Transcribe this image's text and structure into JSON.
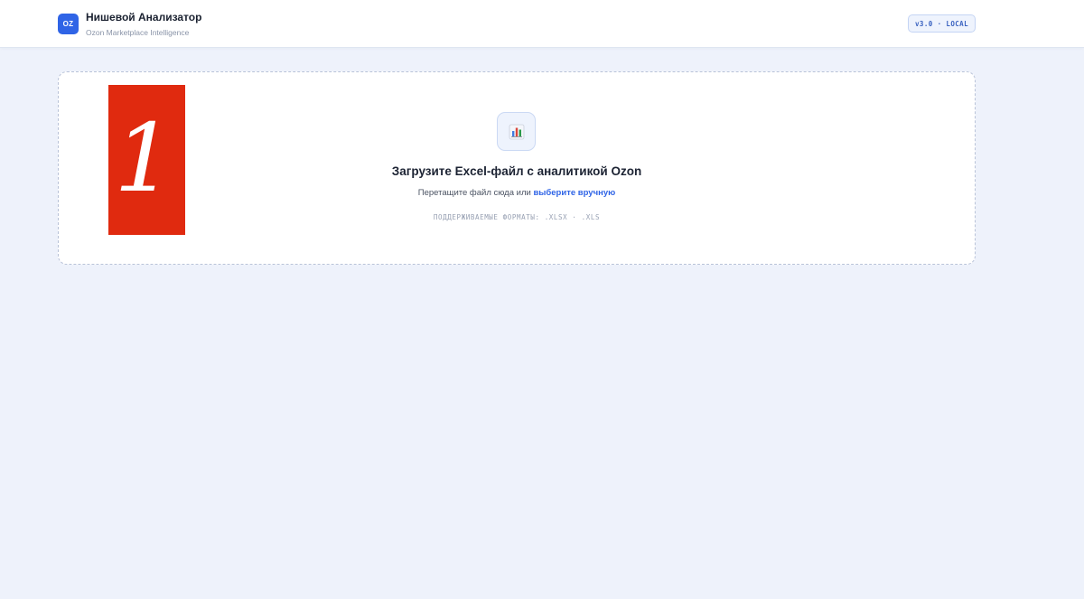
{
  "header": {
    "logo_text": "OZ",
    "title": "Нишевой Анализатор",
    "subtitle": "Ozon Marketplace Intelligence",
    "version": "v3.0 · LOCAL"
  },
  "overlay": {
    "number": "1",
    "color": "#e02a0f"
  },
  "upload": {
    "icon": "bar-chart-icon",
    "title": "Загрузите Excel-файл с аналитикой Ozon",
    "hint_prefix": "Перетащите файл сюда или",
    "hint_link": "выберите вручную",
    "formats": "ПОДДЕРЖИВАЕМЫЕ ФОРМАТЫ: .XLSX · .XLS"
  },
  "colors": {
    "accent": "#2f64e6",
    "background": "#eef2fb"
  }
}
